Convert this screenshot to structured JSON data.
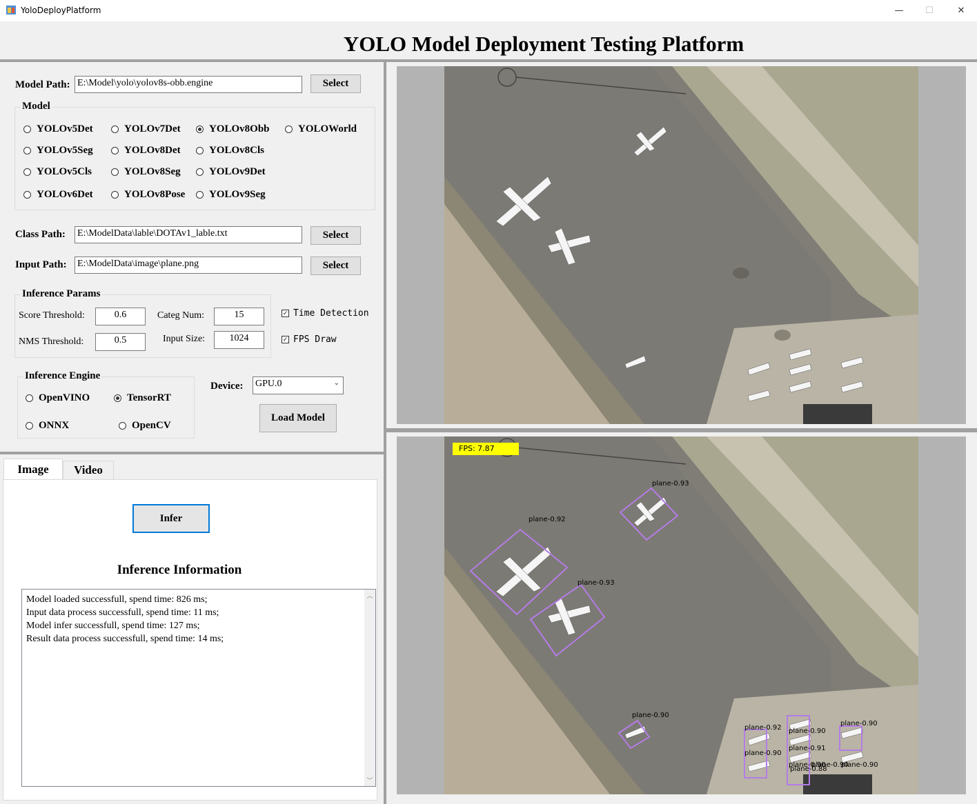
{
  "window": {
    "title": "YoloDeployPlatform",
    "minimize": "—",
    "maximize": "☐",
    "close": "✕"
  },
  "header": {
    "title": "YOLO Model Deployment Testing Platform"
  },
  "model_path": {
    "label": "Model Path:",
    "value": "E:\\Model\\yolo\\yolov8s-obb.engine",
    "button": "Select"
  },
  "model_group": {
    "caption": "Model",
    "options": [
      "YOLOv5Det",
      "YOLOv7Det",
      "YOLOv8Obb",
      "YOLOWorld",
      "YOLOv5Seg",
      "YOLOv8Det",
      "YOLOv8Cls",
      "YOLOv5Cls",
      "YOLOv8Seg",
      "YOLOv9Det",
      "YOLOv6Det",
      "YOLOv8Pose",
      "YOLOv9Seg"
    ],
    "selected": "YOLOv8Obb"
  },
  "class_path": {
    "label": "Class Path:",
    "value": "E:\\ModelData\\lable\\DOTAv1_lable.txt",
    "button": "Select"
  },
  "input_path": {
    "label": "Input Path:",
    "value": "E:\\ModelData\\image\\plane.png",
    "button": "Select"
  },
  "params": {
    "caption": "Inference Params",
    "score_label": "Score Threshold:",
    "score_value": "0.6",
    "nms_label": "NMS Threshold:",
    "nms_value": "0.5",
    "categ_label": "Categ Num:",
    "categ_value": "15",
    "size_label": "Input Size:",
    "size_value": "1024",
    "time_detection": "Time Detection",
    "fps_draw": "FPS Draw"
  },
  "engine": {
    "caption": "Inference Engine",
    "options": [
      "OpenVINO",
      "TensorRT",
      "ONNX",
      "OpenCV"
    ],
    "selected": "TensorRT"
  },
  "device": {
    "label": "Device:",
    "value": "GPU.0"
  },
  "load_button": "Load Model",
  "tabs": {
    "image": "Image",
    "video": "Video"
  },
  "infer_button": "Infer",
  "info": {
    "title": "Inference Information",
    "lines": [
      "Model loaded successfull, spend time: 826 ms;",
      "Input data process successfull, spend time: 11 ms;",
      "Model infer successfull, spend time: 127 ms;",
      "Result data process successfull, spend time: 14 ms;"
    ]
  },
  "result": {
    "fps_text": "FPS: 7.87",
    "detections": [
      "plane-0.93",
      "plane-0.92",
      "plane-0.93",
      "plane-0.90",
      "plane-0.92",
      "plane-0.90",
      "plane-0.91",
      "plane-0.90",
      "plane-0.90",
      "plane-0.90",
      "plane-0.88",
      "plane-0.90",
      "plane-0.90"
    ]
  },
  "colors": {
    "bbox": "#b47ce6",
    "fps_bg": "#ffff00",
    "tarmac": "#7c7a74",
    "grass": "#8e8f78"
  }
}
